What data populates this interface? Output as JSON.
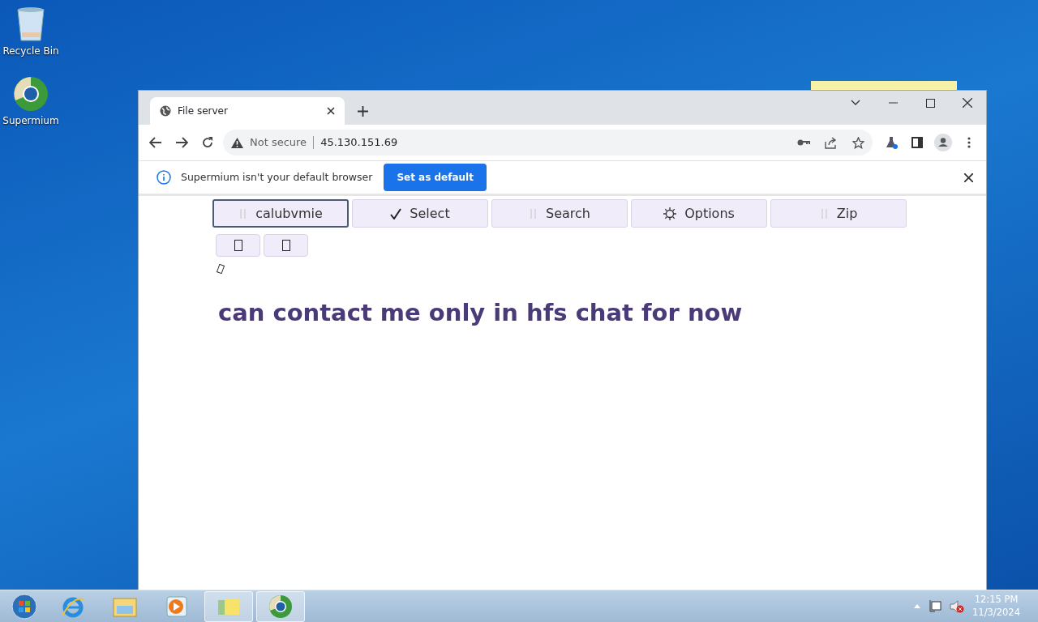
{
  "desktop_icons": [
    {
      "label": "Recycle Bin",
      "kind": "bin"
    },
    {
      "label": "Supermium",
      "kind": "browser"
    }
  ],
  "browser": {
    "tab": {
      "title": "File server"
    },
    "address": {
      "security": "Not secure",
      "url": "45.130.151.69"
    },
    "infobar": {
      "message": "Supermium isn't your default browser",
      "button": "Set as default"
    }
  },
  "page": {
    "toolbar": [
      {
        "label": "calubvmie",
        "kind": "bars",
        "selected": true
      },
      {
        "label": "Select",
        "kind": "check",
        "selected": false
      },
      {
        "label": "Search",
        "kind": "bars",
        "selected": false
      },
      {
        "label": "Options",
        "kind": "gear",
        "selected": false
      },
      {
        "label": "Zip",
        "kind": "bars",
        "selected": false
      }
    ],
    "small_buttons": [
      {
        "kind": "glyph"
      },
      {
        "kind": "glyph"
      }
    ],
    "heading": "can contact me only in hfs chat for now"
  },
  "taskbar": {
    "apps": [
      {
        "kind": "ie",
        "open": false
      },
      {
        "kind": "explorer",
        "open": false
      },
      {
        "kind": "media",
        "open": false
      },
      {
        "kind": "notes",
        "open": true
      },
      {
        "kind": "browser",
        "open": true
      }
    ],
    "time": "12:15 PM",
    "date": "11/3/2024"
  }
}
